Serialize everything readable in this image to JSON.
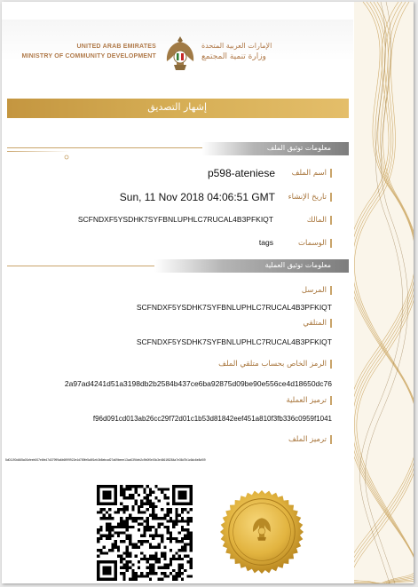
{
  "header": {
    "en_line1": "UNITED ARAB EMIRATES",
    "en_line2": "MINISTRY OF COMMUNITY DEVELOPMENT",
    "ar_line1": "الإمارات العربية المتحدة",
    "ar_line2": "وزارة تنمية المجتمع"
  },
  "title": "إشهار التصديق",
  "file_section": {
    "heading": "معلومات توثيق الملف",
    "fields": [
      {
        "label": "اسم الملف",
        "value": "p598-ateniese"
      },
      {
        "label": "تاريخ الإنشاء",
        "value": "Sun, 11 Nov 2018 04:06:51 GMT"
      },
      {
        "label": "المالك",
        "value": "SCFNDXF5YSDHK7SYFBNLUPHLC7RUCAL4B3PFKIQT"
      },
      {
        "label": "الوسمات",
        "value": "tags"
      }
    ]
  },
  "process_section": {
    "heading": "معلومات توثيق العملية",
    "sender_label": "المرسل",
    "sender_value": "SCFNDXF5YSDHK7SYFBNLUPHLC7RUCAL4B3PFKIQT",
    "receiver_label": "المتلقي",
    "receiver_value": "SCFNDXF5YSDHK7SYFBNLUPHLC7RUCAL4B3PFKIQT",
    "secret_label": "الرمز الخاص بحساب متلقي الملف",
    "secret_value": "2a97ad4241d51a3198db2b2584b437ce6ba92875d09be90e556ce4d18650dc76",
    "txhash_label": "ترميز العملية",
    "txhash_value": "f96d091cd013ab26cc29f72d01c1b53d81842eef451a810f3fb336c0959f1041",
    "filehash_label": "ترميز الملف",
    "filehash_value": "5d01190d465a00cfeeb007e6fe47d37999a6b6999922e4d789fe5a5f1eb3b8ebcaf27a69beee13ca0394eb2c9b0f0e00c3e4661f8284a7e36d7b1c6dc6e8cf09"
  },
  "colors": {
    "gold": "#c49640",
    "label_brown": "#a7743a",
    "section_grey": "#7d7d7d"
  },
  "icons": [
    "uae-emblem-icon",
    "qr-code-icon",
    "gold-seal-icon",
    "gold-wave-decoration"
  ]
}
